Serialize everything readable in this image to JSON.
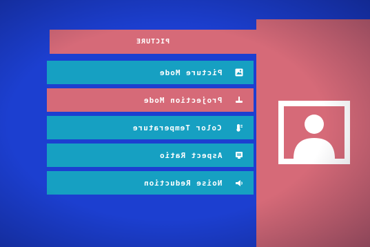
{
  "header": {
    "title": "PICTURE"
  },
  "menu": {
    "items": [
      {
        "label": "Picture Mode",
        "icon": "picture-mode-icon",
        "selected": false
      },
      {
        "label": "Projection Mode",
        "icon": "projection-mode-icon",
        "selected": true
      },
      {
        "label": "Color Temperature",
        "icon": "color-temperature-icon",
        "selected": false
      },
      {
        "label": "Aspect Ratio",
        "icon": "aspect-ratio-icon",
        "selected": false
      },
      {
        "label": "Noise Reduction",
        "icon": "noise-reduction-icon",
        "selected": false
      }
    ]
  },
  "preview": {
    "icon": "user-picture-icon"
  },
  "colors": {
    "background": "#1c3fd0",
    "panel": "#d66a78",
    "item": "#16a0c2",
    "text": "#ffffff"
  }
}
